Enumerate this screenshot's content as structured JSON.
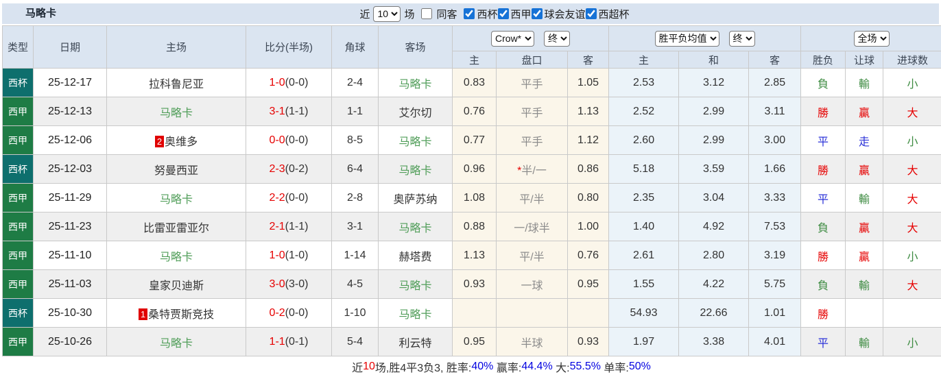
{
  "topbar": {
    "title": "马略卡",
    "recent_label": "近",
    "recent_value": "10",
    "games_label": "场",
    "checkboxes": [
      {
        "label": "同客",
        "checked": false
      },
      {
        "label": "西杯",
        "checked": true
      },
      {
        "label": "西甲",
        "checked": true
      },
      {
        "label": "球会友谊",
        "checked": true
      },
      {
        "label": "西超杯",
        "checked": true
      }
    ]
  },
  "table": {
    "main_headers": [
      "类型",
      "日期",
      "主场",
      "比分(半场)",
      "角球",
      "客场"
    ],
    "bookmaker_select": "Crow*",
    "asian_time_select": "终",
    "europe_select": "胜平负均值",
    "europe_time_select": "终",
    "scope_select": "全场",
    "sub_headers": [
      "主",
      "盘口",
      "客",
      "主",
      "和",
      "客",
      "胜负",
      "让球",
      "进球数"
    ],
    "colors": {
      "cup_badge": "#0e6f6d",
      "league_badge": "#1e7c45",
      "subject_team": "#4f9d58",
      "score_red": "#e60000",
      "win_red": "#e60000",
      "draw_blue": "#2b32d8",
      "loss_green": "#3d8b41"
    },
    "rows": [
      {
        "type": "西杯",
        "type_class": "cup",
        "date": "25-12-17",
        "home": "拉科鲁尼亚",
        "home_subject": false,
        "home_rank": "",
        "score": "1-0",
        "half": "(0-0)",
        "corners": "2-4",
        "away": "马略卡",
        "away_subject": true,
        "ah_home": "0.83",
        "ah_star": false,
        "ah_line": "平手",
        "ah_away": "1.05",
        "eu_home": "2.53",
        "eu_draw": "3.12",
        "eu_away": "2.85",
        "wdl": "負",
        "wdl_color": "green",
        "let": "輸",
        "let_color": "green",
        "goals": "小",
        "goals_color": "green"
      },
      {
        "type": "西甲",
        "type_class": "league",
        "date": "25-12-13",
        "home": "马略卡",
        "home_subject": true,
        "home_rank": "",
        "score": "3-1",
        "half": "(1-1)",
        "corners": "1-1",
        "away": "艾尔切",
        "away_subject": false,
        "ah_home": "0.76",
        "ah_star": false,
        "ah_line": "平手",
        "ah_away": "1.13",
        "eu_home": "2.52",
        "eu_draw": "2.99",
        "eu_away": "3.11",
        "wdl": "勝",
        "wdl_color": "red",
        "let": "贏",
        "let_color": "red",
        "goals": "大",
        "goals_color": "red"
      },
      {
        "type": "西甲",
        "type_class": "league",
        "date": "25-12-06",
        "home": "奥维多",
        "home_subject": false,
        "home_rank": "2",
        "score": "0-0",
        "half": "(0-0)",
        "corners": "8-5",
        "away": "马略卡",
        "away_subject": true,
        "ah_home": "0.77",
        "ah_star": false,
        "ah_line": "平手",
        "ah_away": "1.12",
        "eu_home": "2.60",
        "eu_draw": "2.99",
        "eu_away": "3.00",
        "wdl": "平",
        "wdl_color": "blue",
        "let": "走",
        "let_color": "blue",
        "goals": "小",
        "goals_color": "green"
      },
      {
        "type": "西杯",
        "type_class": "cup",
        "date": "25-12-03",
        "home": "努曼西亚",
        "home_subject": false,
        "home_rank": "",
        "score": "2-3",
        "half": "(0-2)",
        "corners": "6-4",
        "away": "马略卡",
        "away_subject": true,
        "ah_home": "0.96",
        "ah_star": true,
        "ah_line": "半/一",
        "ah_away": "0.86",
        "eu_home": "5.18",
        "eu_draw": "3.59",
        "eu_away": "1.66",
        "wdl": "勝",
        "wdl_color": "red",
        "let": "贏",
        "let_color": "red",
        "goals": "大",
        "goals_color": "red"
      },
      {
        "type": "西甲",
        "type_class": "league",
        "date": "25-11-29",
        "home": "马略卡",
        "home_subject": true,
        "home_rank": "",
        "score": "2-2",
        "half": "(0-0)",
        "corners": "2-8",
        "away": "奥萨苏纳",
        "away_subject": false,
        "ah_home": "1.08",
        "ah_star": false,
        "ah_line": "平/半",
        "ah_away": "0.80",
        "eu_home": "2.35",
        "eu_draw": "3.04",
        "eu_away": "3.33",
        "wdl": "平",
        "wdl_color": "blue",
        "let": "輸",
        "let_color": "green",
        "goals": "大",
        "goals_color": "red"
      },
      {
        "type": "西甲",
        "type_class": "league",
        "date": "25-11-23",
        "home": "比雷亚雷亚尔",
        "home_subject": false,
        "home_rank": "",
        "score": "2-1",
        "half": "(1-1)",
        "corners": "3-1",
        "away": "马略卡",
        "away_subject": true,
        "ah_home": "0.88",
        "ah_star": false,
        "ah_line": "一/球半",
        "ah_away": "1.00",
        "eu_home": "1.40",
        "eu_draw": "4.92",
        "eu_away": "7.53",
        "wdl": "負",
        "wdl_color": "green",
        "let": "贏",
        "let_color": "red",
        "goals": "大",
        "goals_color": "red"
      },
      {
        "type": "西甲",
        "type_class": "league",
        "date": "25-11-10",
        "home": "马略卡",
        "home_subject": true,
        "home_rank": "",
        "score": "1-0",
        "half": "(1-0)",
        "corners": "1-14",
        "away": "赫塔费",
        "away_subject": false,
        "ah_home": "1.13",
        "ah_star": false,
        "ah_line": "平/半",
        "ah_away": "0.76",
        "eu_home": "2.61",
        "eu_draw": "2.80",
        "eu_away": "3.19",
        "wdl": "勝",
        "wdl_color": "red",
        "let": "贏",
        "let_color": "red",
        "goals": "小",
        "goals_color": "green"
      },
      {
        "type": "西甲",
        "type_class": "league",
        "date": "25-11-03",
        "home": "皇家贝迪斯",
        "home_subject": false,
        "home_rank": "",
        "score": "3-0",
        "half": "(3-0)",
        "corners": "4-5",
        "away": "马略卡",
        "away_subject": true,
        "ah_home": "0.93",
        "ah_star": false,
        "ah_line": "一球",
        "ah_away": "0.95",
        "eu_home": "1.55",
        "eu_draw": "4.22",
        "eu_away": "5.75",
        "wdl": "負",
        "wdl_color": "green",
        "let": "輸",
        "let_color": "green",
        "goals": "大",
        "goals_color": "red"
      },
      {
        "type": "西杯",
        "type_class": "cup",
        "date": "25-10-30",
        "home": "桑特贾斯竞技",
        "home_subject": false,
        "home_rank": "1",
        "score": "0-2",
        "half": "(0-0)",
        "corners": "1-10",
        "away": "马略卡",
        "away_subject": true,
        "ah_home": "",
        "ah_star": false,
        "ah_line": "",
        "ah_away": "",
        "eu_home": "54.93",
        "eu_draw": "22.66",
        "eu_away": "1.01",
        "wdl": "勝",
        "wdl_color": "red",
        "let": "",
        "let_color": "",
        "goals": "",
        "goals_color": ""
      },
      {
        "type": "西甲",
        "type_class": "league",
        "date": "25-10-26",
        "home": "马略卡",
        "home_subject": true,
        "home_rank": "",
        "score": "1-1",
        "half": "(0-1)",
        "corners": "5-4",
        "away": "利云特",
        "away_subject": false,
        "ah_home": "0.95",
        "ah_star": false,
        "ah_line": "半球",
        "ah_away": "0.93",
        "eu_home": "1.97",
        "eu_draw": "3.38",
        "eu_away": "4.01",
        "wdl": "平",
        "wdl_color": "blue",
        "let": "輸",
        "let_color": "green",
        "goals": "小",
        "goals_color": "green"
      }
    ]
  },
  "footer": {
    "parts": [
      {
        "text": "近",
        "color": "dark"
      },
      {
        "text": "10",
        "color": "red"
      },
      {
        "text": "场,胜4平3负3, 胜率:",
        "color": "dark"
      },
      {
        "text": "40%",
        "color": "blue"
      },
      {
        "text": " 赢率:",
        "color": "dark"
      },
      {
        "text": "44.4%",
        "color": "blue"
      },
      {
        "text": " 大:",
        "color": "dark"
      },
      {
        "text": "55.5%",
        "color": "blue"
      },
      {
        "text": " 单率:",
        "color": "dark"
      },
      {
        "text": "50%",
        "color": "blue"
      }
    ]
  }
}
